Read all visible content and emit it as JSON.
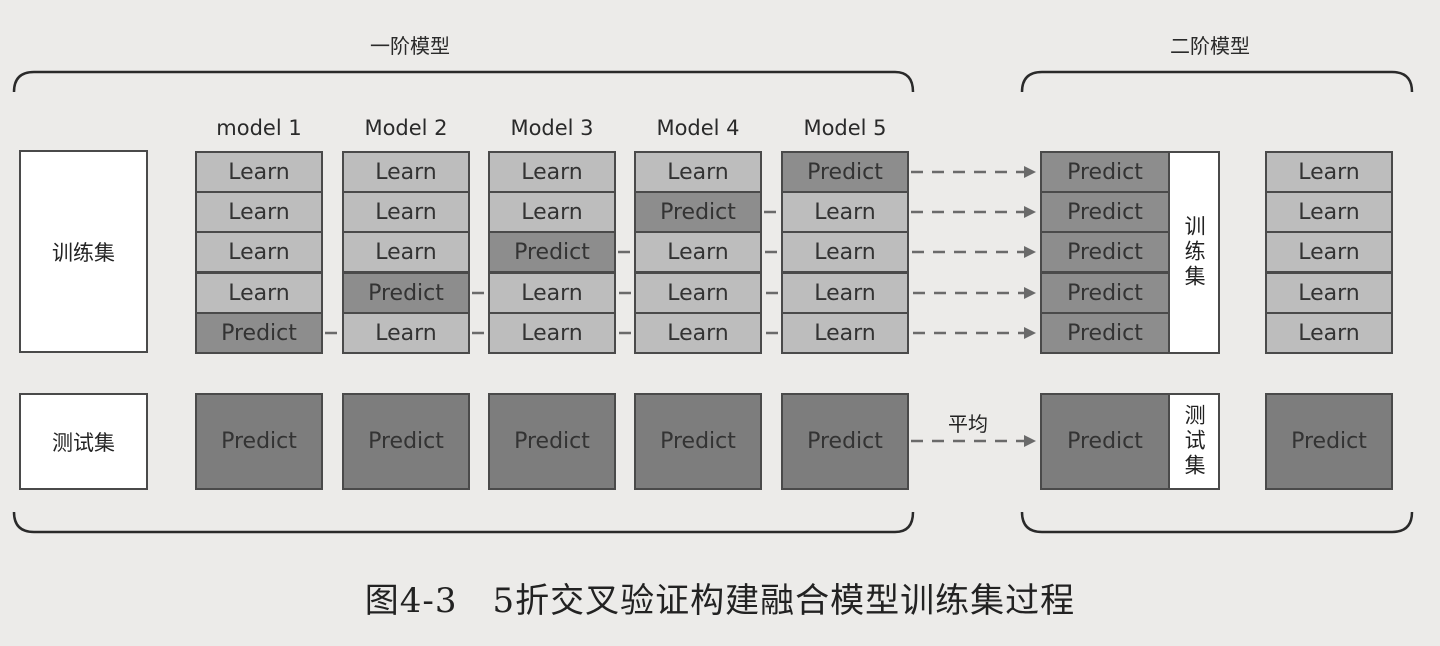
{
  "stage1_title": "一阶模型",
  "stage2_title": "二阶模型",
  "train_label": "训练集",
  "test_label": "测试集",
  "models": [
    "model 1",
    "Model 2",
    "Model 3",
    "Model 4",
    "Model 5"
  ],
  "learn_text": "Learn",
  "predict_text": "Predict",
  "train_grid": [
    [
      "Learn",
      "Learn",
      "Learn",
      "Learn",
      "Predict"
    ],
    [
      "Learn",
      "Learn",
      "Learn",
      "Predict",
      "Learn"
    ],
    [
      "Learn",
      "Learn",
      "Predict",
      "Learn",
      "Learn"
    ],
    [
      "Learn",
      "Predict",
      "Learn",
      "Learn",
      "Learn"
    ],
    [
      "Predict",
      "Learn",
      "Learn",
      "Learn",
      "Learn"
    ]
  ],
  "stage2_train_col": [
    "Predict",
    "Predict",
    "Predict",
    "Predict",
    "Predict"
  ],
  "stage2_learn_col": [
    "Learn",
    "Learn",
    "Learn",
    "Learn",
    "Learn"
  ],
  "stage2_train_vlabel": "训练集",
  "stage2_test_vlabel": "测试集",
  "average_label": "平均",
  "caption": "图4-3　5折交叉验证构建融合模型训练集过程"
}
